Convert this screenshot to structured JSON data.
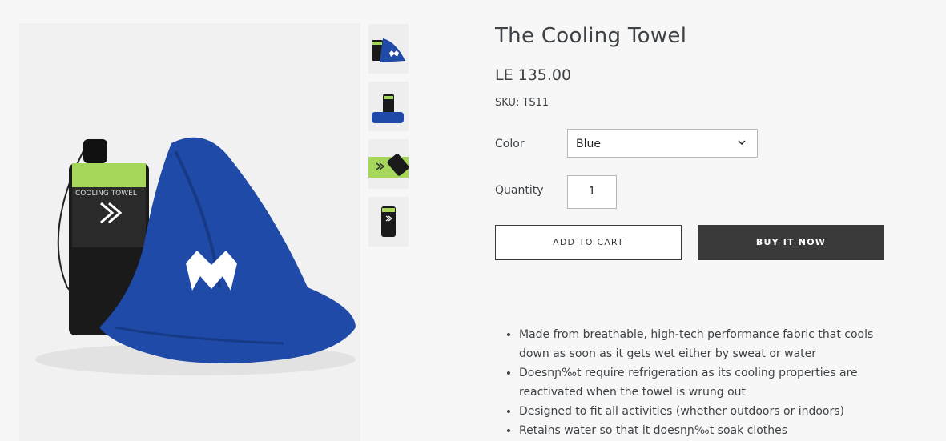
{
  "product": {
    "title": "The Cooling Towel",
    "price": "LE 135.00",
    "sku": "SKU: TS11",
    "color_label": "Color",
    "color_value": "Blue",
    "quantity_label": "Quantity",
    "quantity_value": "1",
    "add_to_cart": "ADD TO CART",
    "buy_now": "BUY IT NOW",
    "bag_label": "COOLING TOWEL"
  },
  "description": [
    "Made from breathable, high-tech performance fabric that cools down as soon as it gets wet either by sweat or water",
    "Doesnɲ‰t require refrigeration as its cooling properties are reactivated when the towel is wrung out",
    "Designed to fit all activities (whether outdoors or indoors)",
    "Retains water so that it doesnɲ‰t soak clothes"
  ],
  "colors": {
    "towel": "#1f4aa8",
    "accent": "#a6d65a",
    "button_dark": "#3a3a3a"
  }
}
